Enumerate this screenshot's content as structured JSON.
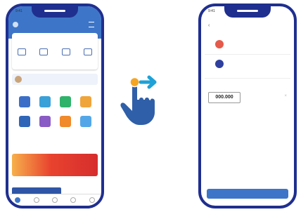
{
  "left_phone": {
    "status_time": "9:41",
    "header_brand": "",
    "account_left": "",
    "account_right": "",
    "quick_caps": [
      "",
      "",
      "",
      ""
    ],
    "promo_text": "",
    "services_title": "",
    "tile_colors": [
      "#3b6fc7",
      "#3aa0d8",
      "#2fb36b",
      "#f0a53a",
      "#2f66b8",
      "#8a5bc4",
      "#f08a2a",
      "#53a7e8"
    ],
    "tile_caps": [
      "",
      "",
      "",
      "",
      "",
      "",
      "",
      ""
    ],
    "banner_text": "",
    "section2_title": ""
  },
  "gesture": {
    "accent": "#1ea1d7",
    "dot": "#f4a521",
    "hand": "#2f5fa8"
  },
  "right_phone": {
    "status_time": "9:41",
    "title": "",
    "from_label": "",
    "from_name": "",
    "from_value": "",
    "to_label": "",
    "to_name": "",
    "amount_label": "",
    "amount_value": "000.000",
    "fee_text": "",
    "option1": "",
    "option2": "",
    "continue_label": ""
  }
}
